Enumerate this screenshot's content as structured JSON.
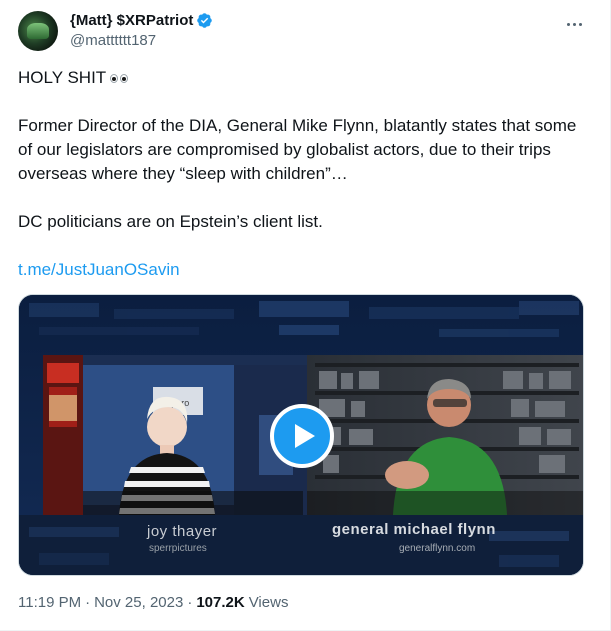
{
  "author": {
    "display_name": "{Matt} $XRPatriot",
    "handle": "@matttttt187",
    "verified": true
  },
  "tweet": {
    "line1": "HOLY SHIT",
    "paragraph2": "Former Director of the DIA, General Mike Flynn, blatantly states that some of our legislators are compromised by globalist actors, due to their trips overseas where they “sleep with children”…",
    "paragraph3": "DC politicians are on Epstein’s client list.",
    "link": "t.me/JustJuanOSavin"
  },
  "video": {
    "left_caption_name": "joy thayer",
    "left_caption_sub": "sperrpictures",
    "right_caption_name": "general michael flynn",
    "right_caption_sub": "generalflynn.com"
  },
  "meta": {
    "time": "11:19 PM",
    "date": "Nov 25, 2023",
    "separator": "·",
    "views_count": "107.2K",
    "views_label": "Views"
  },
  "colors": {
    "accent": "#1d9bf0",
    "text_primary": "#0f1419",
    "text_secondary": "#536471"
  },
  "icons": {
    "verified": "verified-badge-icon",
    "more": "more-horizontal-icon",
    "play": "play-icon",
    "eyes": "eyes-emoji-icon"
  }
}
